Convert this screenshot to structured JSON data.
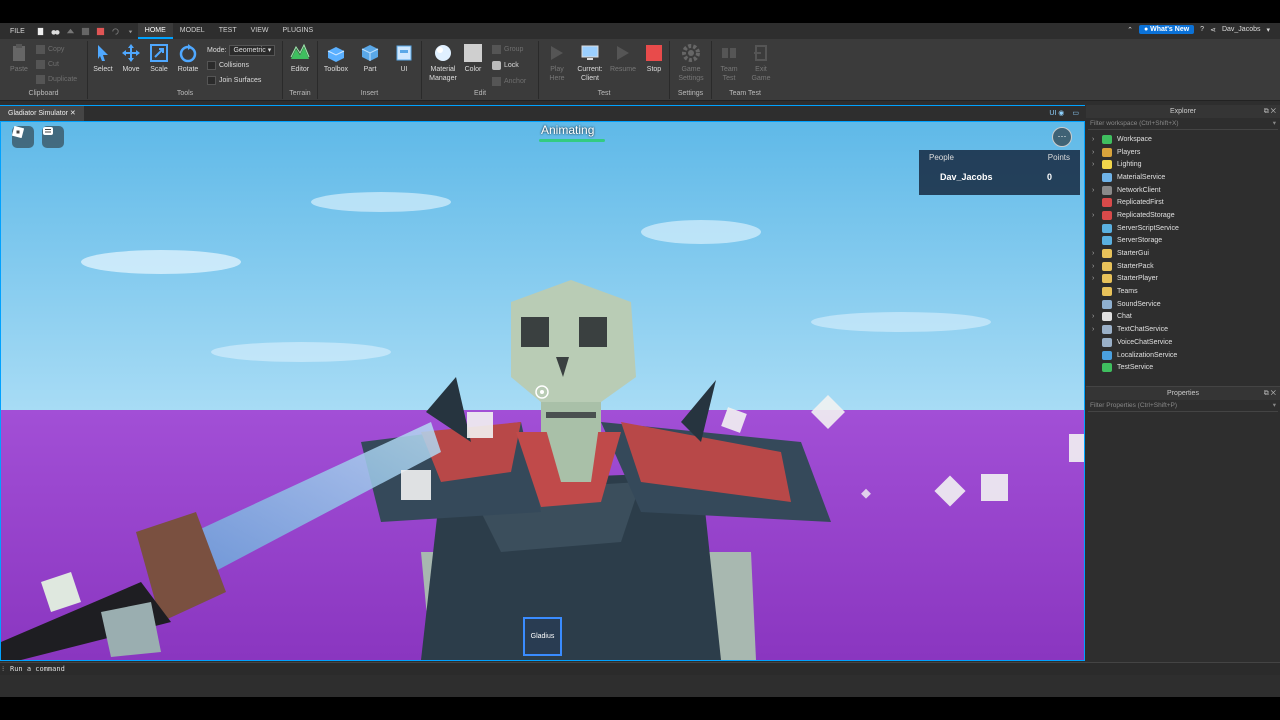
{
  "menubar": {
    "file": "FILE",
    "tabs": [
      "HOME",
      "MODEL",
      "TEST",
      "VIEW",
      "PLUGINS"
    ],
    "whats_new": "What's New",
    "username": "Dav_Jacobs"
  },
  "ribbon": {
    "clipboard": {
      "paste": "Paste",
      "copy": "Copy",
      "cut": "Cut",
      "duplicate": "Duplicate",
      "group": "Clipboard"
    },
    "tools": {
      "select": "Select",
      "move": "Move",
      "scale": "Scale",
      "rotate": "Rotate",
      "mode_label": "Mode:",
      "mode_value": "Geometric",
      "collisions": "Collisions",
      "join_surfaces": "Join Surfaces",
      "group": "Tools"
    },
    "terrain": {
      "editor": "Editor",
      "group": "Terrain"
    },
    "insert": {
      "toolbox": "Toolbox",
      "part": "Part",
      "ui": "UI",
      "group": "Insert"
    },
    "edit": {
      "material_manager_1": "Material",
      "material_manager_2": "Manager",
      "color": "Color",
      "group_btn": "Group",
      "lock": "Lock",
      "anchor": "Anchor",
      "group": "Edit"
    },
    "test": {
      "play_here_1": "Play",
      "play_here_2": "Here",
      "current_client_1": "Current:",
      "current_client_2": "Client",
      "resume": "Resume",
      "stop": "Stop",
      "group": "Test"
    },
    "settings": {
      "game_settings_1": "Game",
      "game_settings_2": "Settings",
      "group": "Settings"
    },
    "team_test": {
      "team_test_1": "Team",
      "team_test_2": "Test",
      "exit_game_1": "Exit",
      "exit_game_2": "Game",
      "group": "Team Test"
    }
  },
  "viewport": {
    "tab_title": "Gladiator Simulator",
    "ui_toggle": "UI",
    "animating": "Animating",
    "leaderboard": {
      "col_people": "People",
      "col_points": "Points",
      "player": "Dav_Jacobs",
      "points": "0"
    },
    "hotbar_item": "Gladius"
  },
  "command": {
    "placeholder": "Run a command"
  },
  "explorer": {
    "title": "Explorer",
    "filter": "Filter workspace (Ctrl+Shift+X)",
    "items": [
      {
        "label": "Workspace",
        "expand": true,
        "color": "#3fbf5f"
      },
      {
        "label": "Players",
        "expand": true,
        "color": "#d9a43c"
      },
      {
        "label": "Lighting",
        "expand": true,
        "color": "#f2d64b"
      },
      {
        "label": "MaterialService",
        "expand": false,
        "color": "#6fb3e8"
      },
      {
        "label": "NetworkClient",
        "expand": true,
        "color": "#8a8a8a"
      },
      {
        "label": "ReplicatedFirst",
        "expand": false,
        "color": "#d94a4a"
      },
      {
        "label": "ReplicatedStorage",
        "expand": true,
        "color": "#d94a4a"
      },
      {
        "label": "ServerScriptService",
        "expand": false,
        "color": "#5ab0e0"
      },
      {
        "label": "ServerStorage",
        "expand": false,
        "color": "#5ab0e0"
      },
      {
        "label": "StarterGui",
        "expand": true,
        "color": "#e8c25a"
      },
      {
        "label": "StarterPack",
        "expand": true,
        "color": "#e8c25a"
      },
      {
        "label": "StarterPlayer",
        "expand": true,
        "color": "#e8c25a"
      },
      {
        "label": "Teams",
        "expand": false,
        "color": "#e8c25a"
      },
      {
        "label": "SoundService",
        "expand": false,
        "color": "#8fb0d0"
      },
      {
        "label": "Chat",
        "expand": true,
        "color": "#e0e0e0"
      },
      {
        "label": "TextChatService",
        "expand": true,
        "color": "#9ab0c8"
      },
      {
        "label": "VoiceChatService",
        "expand": false,
        "color": "#9ab0c8"
      },
      {
        "label": "LocalizationService",
        "expand": false,
        "color": "#4aa0e0"
      },
      {
        "label": "TestService",
        "expand": false,
        "color": "#3fbf5f"
      }
    ]
  },
  "properties": {
    "title": "Properties",
    "filter": "Filter Properties (Ctrl+Shift+P)"
  }
}
